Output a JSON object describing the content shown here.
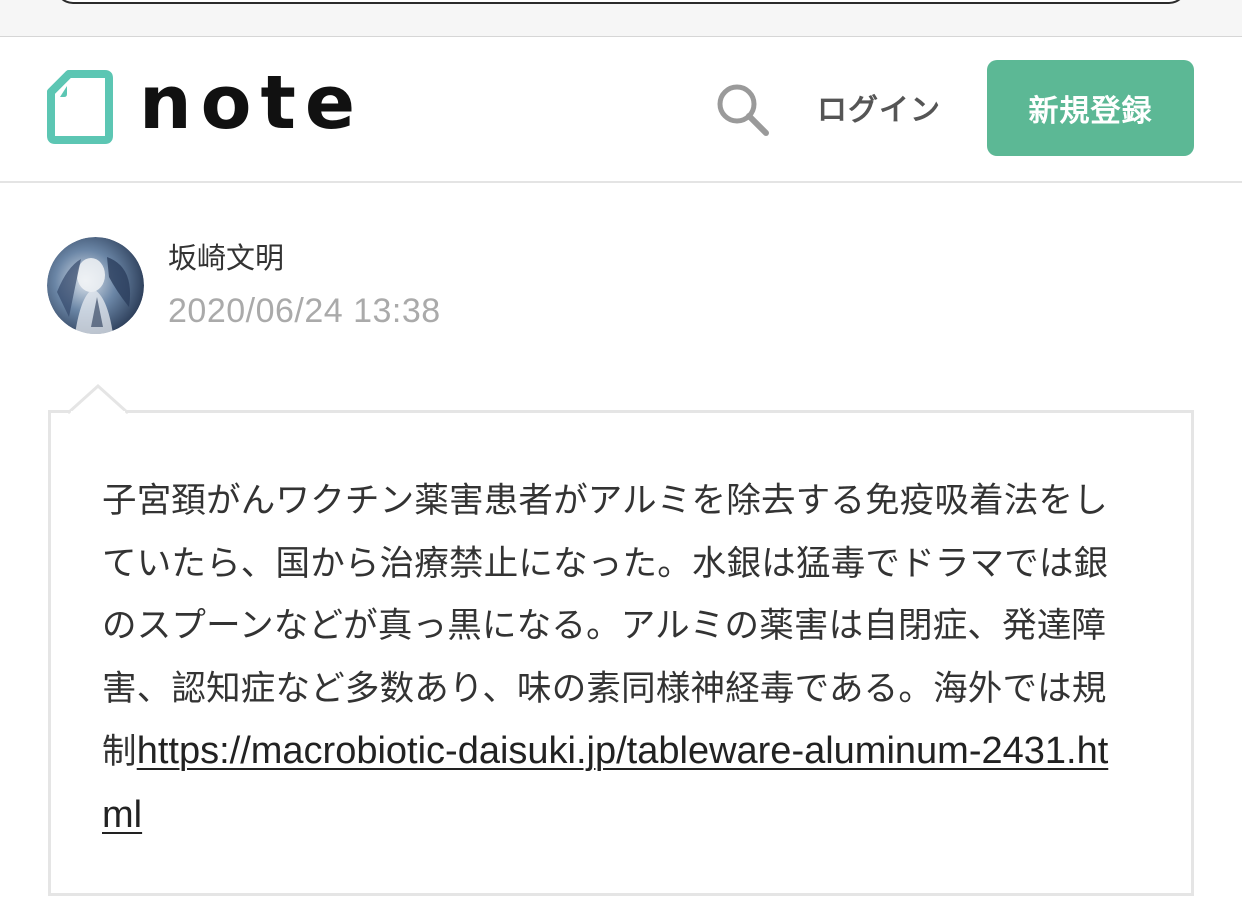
{
  "header": {
    "logo_text": "note",
    "login_label": "ログイン",
    "signup_label": "新規登録"
  },
  "icons": {
    "logo": "note-logo-icon",
    "search": "search-icon",
    "avatar": "avatar"
  },
  "colors": {
    "brand_green": "#5cb895",
    "logo_teal": "#5cc6b3",
    "text_main": "#333333",
    "text_muted": "#aaaaaa"
  },
  "post": {
    "author_name": "坂崎文明",
    "timestamp": "2020/06/24 13:38",
    "body_text": "子宮頚がんワクチン薬害患者がアルミを除去する免疫吸着法をしていたら、国から治療禁止になった。水銀は猛毒でドラマでは銀のスプーンなどが真っ黒になる。アルミの薬害は自閉症、発達障害、認知症など多数あり、味の素同様神経毒である。海外では規制",
    "link_text": "https://macrobiotic-daisuki.jp/tableware-aluminum-2431.html"
  }
}
